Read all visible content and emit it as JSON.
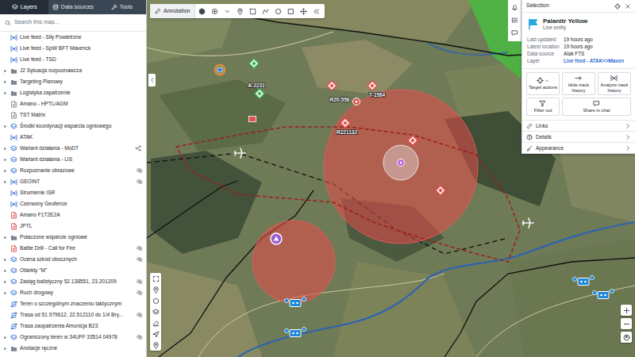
{
  "tabs": [
    {
      "label": "Layers",
      "selected": true
    },
    {
      "label": "Data sources",
      "selected": false
    },
    {
      "label": "Tools",
      "selected": false
    }
  ],
  "search": {
    "placeholder": "Search this map..."
  },
  "layers": [
    {
      "label": "Live feed - Siły Powietrzne",
      "kind": "feed",
      "expandable": false,
      "hidden": false,
      "shared": false
    },
    {
      "label": "Live feed - SpW BFT Maverick",
      "kind": "feed",
      "expandable": false,
      "hidden": false,
      "shared": false
    },
    {
      "label": "Live feed - TSD",
      "kind": "feed",
      "expandable": false,
      "hidden": false,
      "shared": false
    },
    {
      "label": "J2 Sytuacja rozpoznawcza",
      "kind": "folder",
      "expandable": true,
      "hidden": false,
      "shared": false
    },
    {
      "label": "Targeting Planowy",
      "kind": "folder",
      "expandable": true,
      "hidden": false,
      "shared": false
    },
    {
      "label": "Logistyka zapatrzenie",
      "kind": "folder",
      "expandable": true,
      "hidden": false,
      "shared": false
    },
    {
      "label": "Amano - HPTL/AGM",
      "kind": "file",
      "expandable": false,
      "hidden": false,
      "shared": false
    },
    {
      "label": "TST Matrix",
      "kind": "file",
      "expandable": false,
      "hidden": false,
      "shared": false
    },
    {
      "label": "Środki koordynacji wsparcia ogniowego",
      "kind": "layer",
      "expandable": true,
      "hidden": false,
      "shared": false
    },
    {
      "label": "ATAK",
      "kind": "feed",
      "expandable": false,
      "hidden": false,
      "shared": false
    },
    {
      "label": "Wariant działania - MoDT",
      "kind": "layer",
      "expandable": true,
      "hidden": false,
      "shared": true
    },
    {
      "label": "Wariant działania - LIS",
      "kind": "layer",
      "expandable": true,
      "hidden": false,
      "shared": false
    },
    {
      "label": "Rozpoznanie obrazowe",
      "kind": "layer",
      "expandable": true,
      "hidden": true,
      "shared": false
    },
    {
      "label": "GEOINT",
      "kind": "feed",
      "expandable": true,
      "hidden": true,
      "shared": false
    },
    {
      "label": "Strumienie ISR",
      "kind": "feed",
      "expandable": false,
      "hidden": false,
      "shared": false
    },
    {
      "label": "Czerwony Geofence",
      "kind": "feed",
      "expandable": false,
      "hidden": false,
      "shared": false
    },
    {
      "label": "Amano F1T2E2A",
      "kind": "redfile",
      "expandable": false,
      "hidden": false,
      "shared": false
    },
    {
      "label": "JPTL",
      "kind": "redfile",
      "expandable": false,
      "hidden": false,
      "shared": false
    },
    {
      "label": "Połaczone wsparcie ogniowe",
      "kind": "folder",
      "expandable": true,
      "hidden": false,
      "shared": false
    },
    {
      "label": "Battle Drill - Call for Fire",
      "kind": "redfile",
      "expandable": false,
      "hidden": true,
      "shared": false
    },
    {
      "label": "Ocena szkód ubocznych",
      "kind": "layer",
      "expandable": true,
      "hidden": true,
      "shared": false
    },
    {
      "label": "Obiekty \"M\"",
      "kind": "layer",
      "expandable": true,
      "hidden": false,
      "shared": false
    },
    {
      "label": "Zasięg balistyczny 52.138551, 23.201209",
      "kind": "layer",
      "expandable": true,
      "hidden": true,
      "shared": false
    },
    {
      "label": "Ruch drogowy",
      "kind": "layer",
      "expandable": true,
      "hidden": true,
      "shared": false
    },
    {
      "label": "Teren o szczególnym znaczeniu taktycznym",
      "kind": "route",
      "expandable": false,
      "hidden": false,
      "shared": false
    },
    {
      "label": "Trasa od 51.979612, 22.512110 do 1/4 Bry...",
      "kind": "route",
      "expandable": false,
      "hidden": true,
      "shared": false
    },
    {
      "label": "Trasa zaopatrzenia Amunicja B23",
      "kind": "route",
      "expandable": false,
      "hidden": false,
      "shared": false
    },
    {
      "label": "Ograniczony teren w 34UFF 33514 04978",
      "kind": "layer",
      "expandable": true,
      "hidden": true,
      "shared": false
    },
    {
      "label": "Anotacje ręczne",
      "kind": "folder",
      "expandable": true,
      "hidden": false,
      "shared": false
    }
  ],
  "toolbar": {
    "annotation": "Annotation"
  },
  "selection": {
    "title": "Selection",
    "name": "Palanitr Yellow",
    "subtitle": "Live entity",
    "meta": [
      {
        "key": "Last updated",
        "value": "19 hours ago",
        "link": false
      },
      {
        "key": "Latest location",
        "value": "19 hours ago",
        "link": false
      },
      {
        "key": "Data source",
        "value": "Atak FTS",
        "link": false
      },
      {
        "key": "Layer",
        "value": "Live feed - ATAK<>Maven",
        "link": true
      }
    ],
    "actions": [
      {
        "label": "Target actions",
        "kind": "menu"
      },
      {
        "label": "Hide track history",
        "kind": "button"
      },
      {
        "label": "Analyze track history",
        "kind": "button"
      },
      {
        "label": "Filter out",
        "kind": "button"
      },
      {
        "label": "Share in chat",
        "kind": "button"
      }
    ],
    "sections": [
      {
        "label": "Links",
        "expanded": false
      },
      {
        "label": "Details",
        "expanded": false
      },
      {
        "label": "Appearance",
        "expanded": false
      }
    ]
  },
  "map": {
    "markers": [
      {
        "kind": "ring",
        "color": "#e88a2a"
      },
      {
        "kind": "diamond",
        "color": "#3fae5a"
      },
      {
        "kind": "diamond",
        "color": "#3fae5a",
        "label": "A-2231"
      },
      {
        "kind": "diamond",
        "color": "#e0524f",
        "label": "R20-556"
      },
      {
        "kind": "diamond",
        "color": "#e0524f",
        "label": "T-1564"
      },
      {
        "kind": "target",
        "color": "#e0524f"
      },
      {
        "kind": "square",
        "color": "#e0524f"
      },
      {
        "kind": "diamond",
        "color": "#e0524f",
        "label": "R221132"
      },
      {
        "kind": "diamond",
        "color": "#e0524f"
      },
      {
        "kind": "target",
        "color": "#b85fd6"
      },
      {
        "kind": "diamond",
        "color": "#e0524f"
      },
      {
        "kind": "plane",
        "color": "#f4f4f4"
      },
      {
        "kind": "plane",
        "color": "#f4f4f4"
      },
      {
        "kind": "circle",
        "color": "#9b5fd0"
      },
      {
        "kind": "unit",
        "color": "#1e88d8"
      },
      {
        "kind": "unit",
        "color": "#1e88d8"
      },
      {
        "kind": "unit",
        "color": "#1e88d8"
      },
      {
        "kind": "unit",
        "color": "#1e88d8"
      }
    ]
  }
}
